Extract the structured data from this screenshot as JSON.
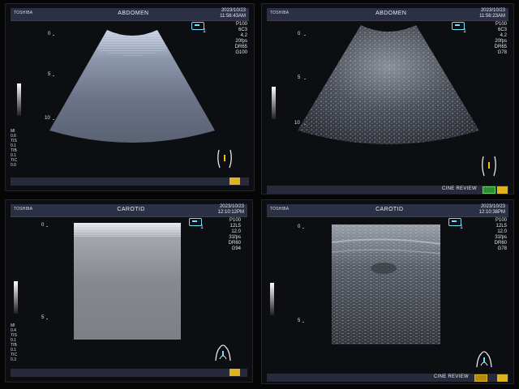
{
  "monitors": [
    {
      "brand": "TOSHIBA",
      "preset": "ABDOMEN",
      "date": "2023/10/23",
      "time": "11:56:43AM",
      "params": [
        "P100",
        "6C3",
        "4.2",
        "20fps",
        "DR65",
        "G100"
      ],
      "depth_labels": [
        "0",
        "5",
        "10"
      ],
      "ti_lines": [
        "MI",
        "0.6",
        "TIS",
        "0.1",
        "TIB",
        "0.1",
        "TIC",
        "0.0"
      ],
      "probe_marker": "1"
    },
    {
      "brand": "TOSHIBA",
      "preset": "ABDOMEN",
      "date": "2023/10/23",
      "time": "11:56:23AM",
      "params": [
        "P100",
        "6C3",
        "4.2",
        "20fps",
        "DR65",
        "G78"
      ],
      "depth_labels": [
        "0",
        "5",
        "10"
      ],
      "probe_marker": "1",
      "status": "CINE REVIEW"
    },
    {
      "brand": "TOSHIBA",
      "preset": "CAROTID",
      "date": "2023/10/23",
      "time": "12:10:12PM",
      "params": [
        "P100",
        "12L5",
        "12.0",
        "31fps",
        "DR60",
        "G94"
      ],
      "depth_labels": [
        "0",
        "5"
      ],
      "ti_lines": [
        "MI",
        "0.4",
        "TIS",
        "0.1",
        "TIB",
        "0.1",
        "TIC",
        "0.3"
      ],
      "probe_marker": "1"
    },
    {
      "brand": "TOSHIBA",
      "preset": "CAROTID",
      "date": "2023/10/23",
      "time": "12:10:38PM",
      "params": [
        "P100",
        "12L5",
        "12.0",
        "31fps",
        "DR60",
        "G78"
      ],
      "depth_labels": [
        "0",
        "5"
      ],
      "probe_marker": "1",
      "status": "CINE REVIEW"
    }
  ]
}
